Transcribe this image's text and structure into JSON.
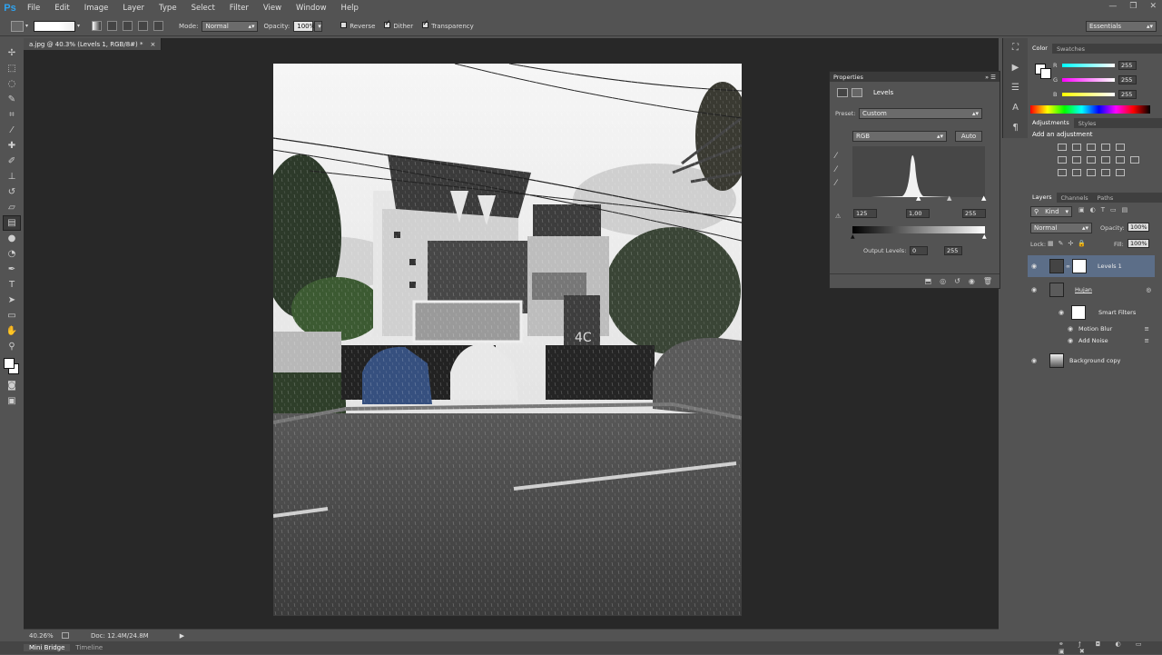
{
  "app": {
    "logo": "Ps",
    "workspace": "Essentials"
  },
  "menu": [
    "File",
    "Edit",
    "Image",
    "Layer",
    "Type",
    "Select",
    "Filter",
    "View",
    "Window",
    "Help"
  ],
  "options": {
    "mode_label": "Mode:",
    "mode_value": "Normal",
    "opacity_label": "Opacity:",
    "opacity_value": "100%",
    "reverse": "Reverse",
    "dither": "Dither",
    "transparency": "Transparency"
  },
  "document": {
    "tab": "a.jpg @ 40.3% (Levels 1, RGB/8#) *",
    "zoom": "40.26%",
    "doc_size": "Doc: 12.4M/24.8M",
    "plate": "4C"
  },
  "bottom_tabs": [
    "Mini Bridge",
    "Timeline"
  ],
  "properties": {
    "title": "Properties",
    "adjustment": "Levels",
    "preset_label": "Preset:",
    "preset_value": "Custom",
    "channel": "RGB",
    "auto": "Auto",
    "input_black": "125",
    "input_gamma": "1,00",
    "input_white": "255",
    "output_label": "Output Levels:",
    "output_black": "0",
    "output_white": "255"
  },
  "color_panel": {
    "tabs": [
      "Color",
      "Swatches"
    ],
    "r_label": "R",
    "g_label": "G",
    "b_label": "B",
    "r": "255",
    "g": "255",
    "b": "255"
  },
  "adjustments_panel": {
    "tabs": [
      "Adjustments",
      "Styles"
    ],
    "heading": "Add an adjustment"
  },
  "layers_panel": {
    "tabs": [
      "Layers",
      "Channels",
      "Paths"
    ],
    "kind": "Kind",
    "blend": "Normal",
    "opacity_label": "Opacity:",
    "opacity": "100%",
    "lock_label": "Lock:",
    "fill_label": "Fill:",
    "fill": "100%",
    "layers": {
      "levels": "Levels 1",
      "hujan": "Hujan",
      "smart_filters": "Smart Filters",
      "motion_blur": "Motion Blur",
      "add_noise": "Add Noise",
      "background": "Background copy"
    }
  }
}
